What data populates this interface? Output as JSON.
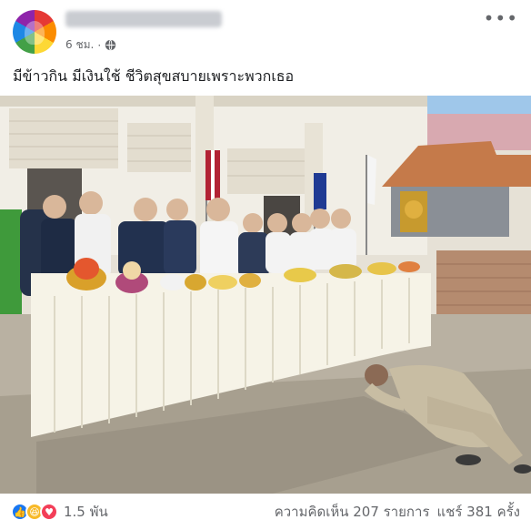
{
  "post": {
    "author_name": "",
    "time": "6 ชม.",
    "privacy_icon": "globe-icon",
    "more_icon": "more-options-icon",
    "caption": "มีข้าวกิน มีเงินใช้ ชีวิตสุขสบายเพราะพวกเธอ"
  },
  "photo": {
    "description_colors": {
      "sky": "#9fc7ea",
      "wall": "#f1eee6",
      "tablecloth": "#f6f3e7",
      "ground": "#b9b1a2",
      "uniform_dark": "#25324a",
      "uniform_khaki": "#c8bda3"
    }
  },
  "footer": {
    "reaction_icons": [
      "like-icon",
      "haha-icon",
      "love-icon"
    ],
    "reaction_count": "1.5 พัน",
    "comments": "ความคิดเห็น 207 รายการ",
    "shares": "แชร์ 381 ครั้ง"
  }
}
